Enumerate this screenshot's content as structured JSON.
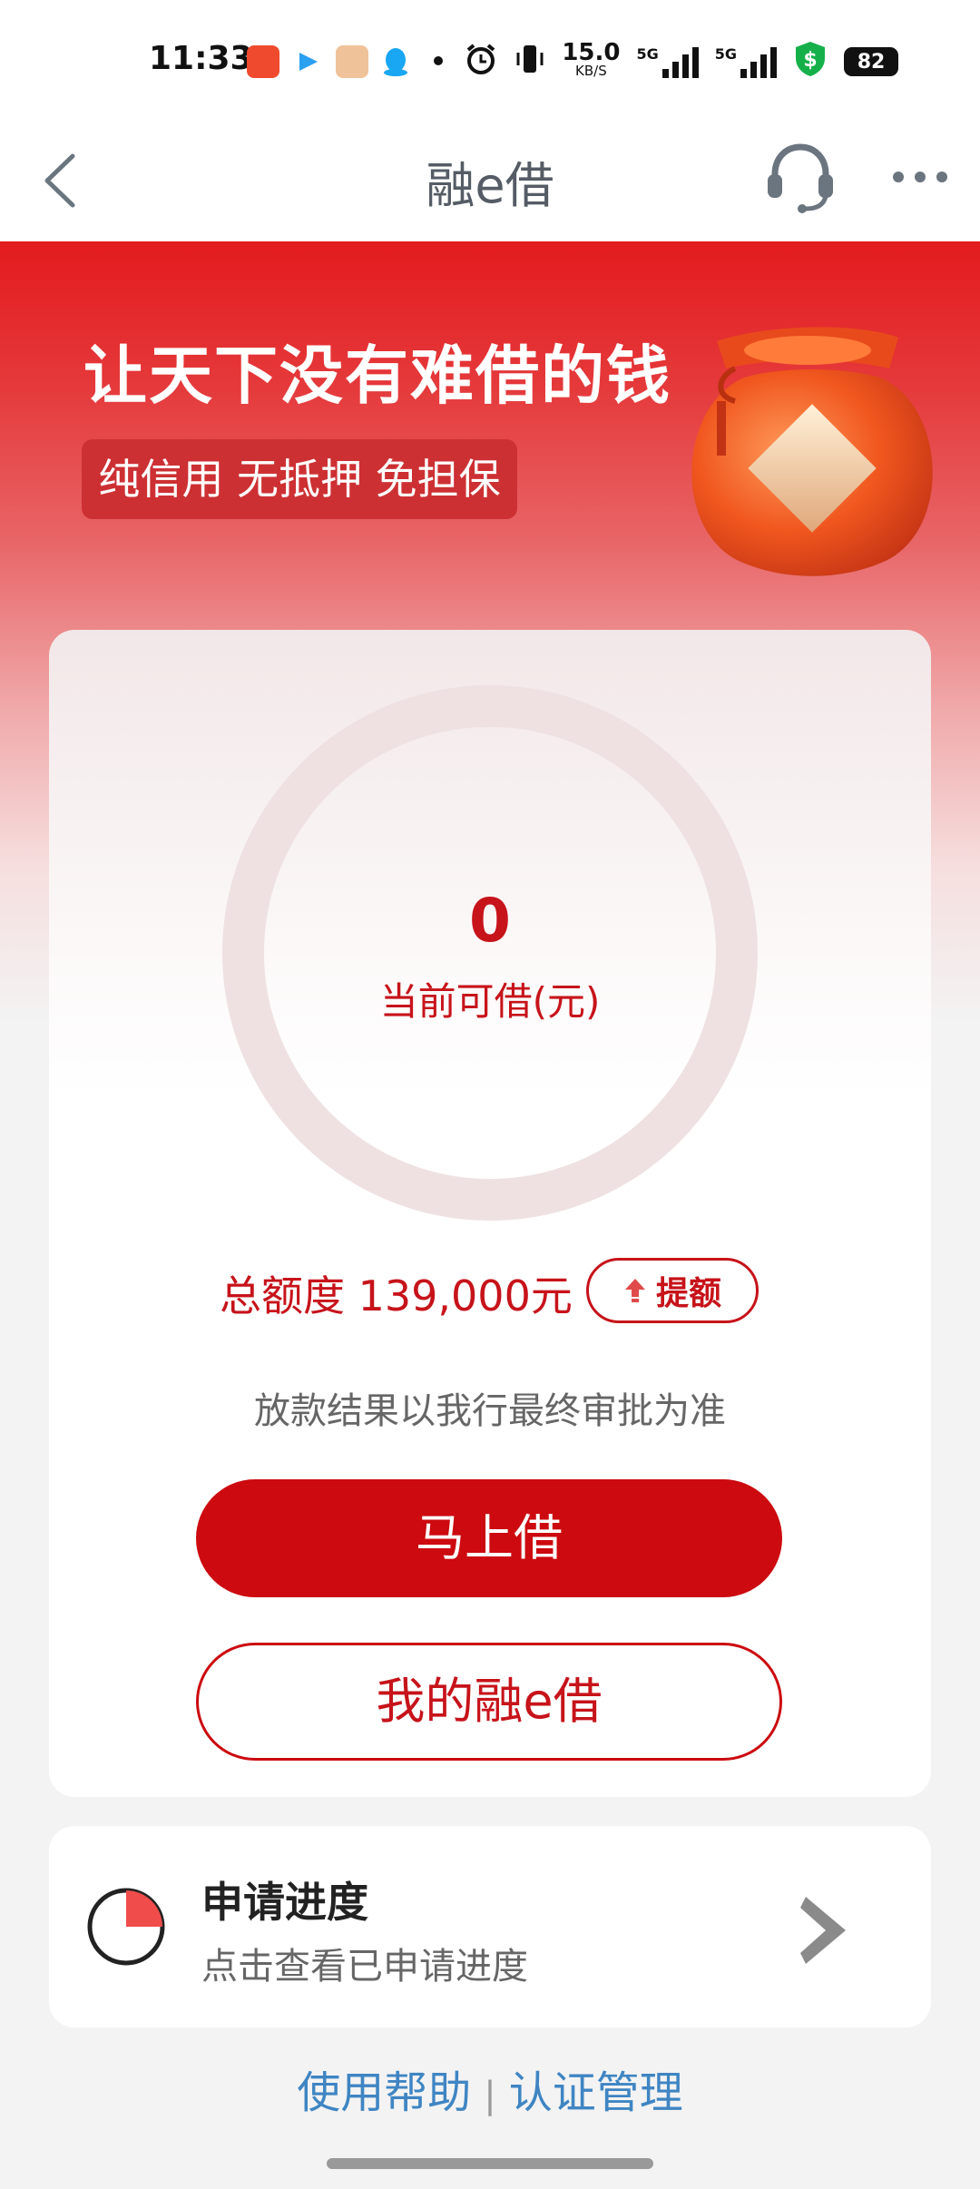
{
  "status_bar": {
    "time": "11:33",
    "network_speed": "15.0",
    "network_speed_unit": "KB/S",
    "signal_label_1": "5G",
    "signal_label_2": "5G",
    "battery": "82"
  },
  "nav": {
    "title": "融e借",
    "back_icon": "chevron-left-icon",
    "support_icon": "headset-icon",
    "more_icon": "more-icon"
  },
  "hero": {
    "headline": "让天下没有难借的钱",
    "subtitle": "纯信用 无抵押 免担保"
  },
  "credit": {
    "available_amount": "0",
    "available_label": "当前可借(元)",
    "total_label": "总额度 139,000元",
    "raise_label": "提额",
    "notice": "放款结果以我行最终审批为准",
    "borrow_button": "马上借",
    "my_loans_button": "我的融e借"
  },
  "progress": {
    "title": "申请进度",
    "subtitle": "点击查看已申请进度"
  },
  "footer": {
    "help_link": "使用帮助",
    "separator": "|",
    "auth_link": "认证管理"
  },
  "colors": {
    "brand_red": "#cc0a0f",
    "text_red": "#c7131a",
    "link_blue": "#3f85c3"
  }
}
